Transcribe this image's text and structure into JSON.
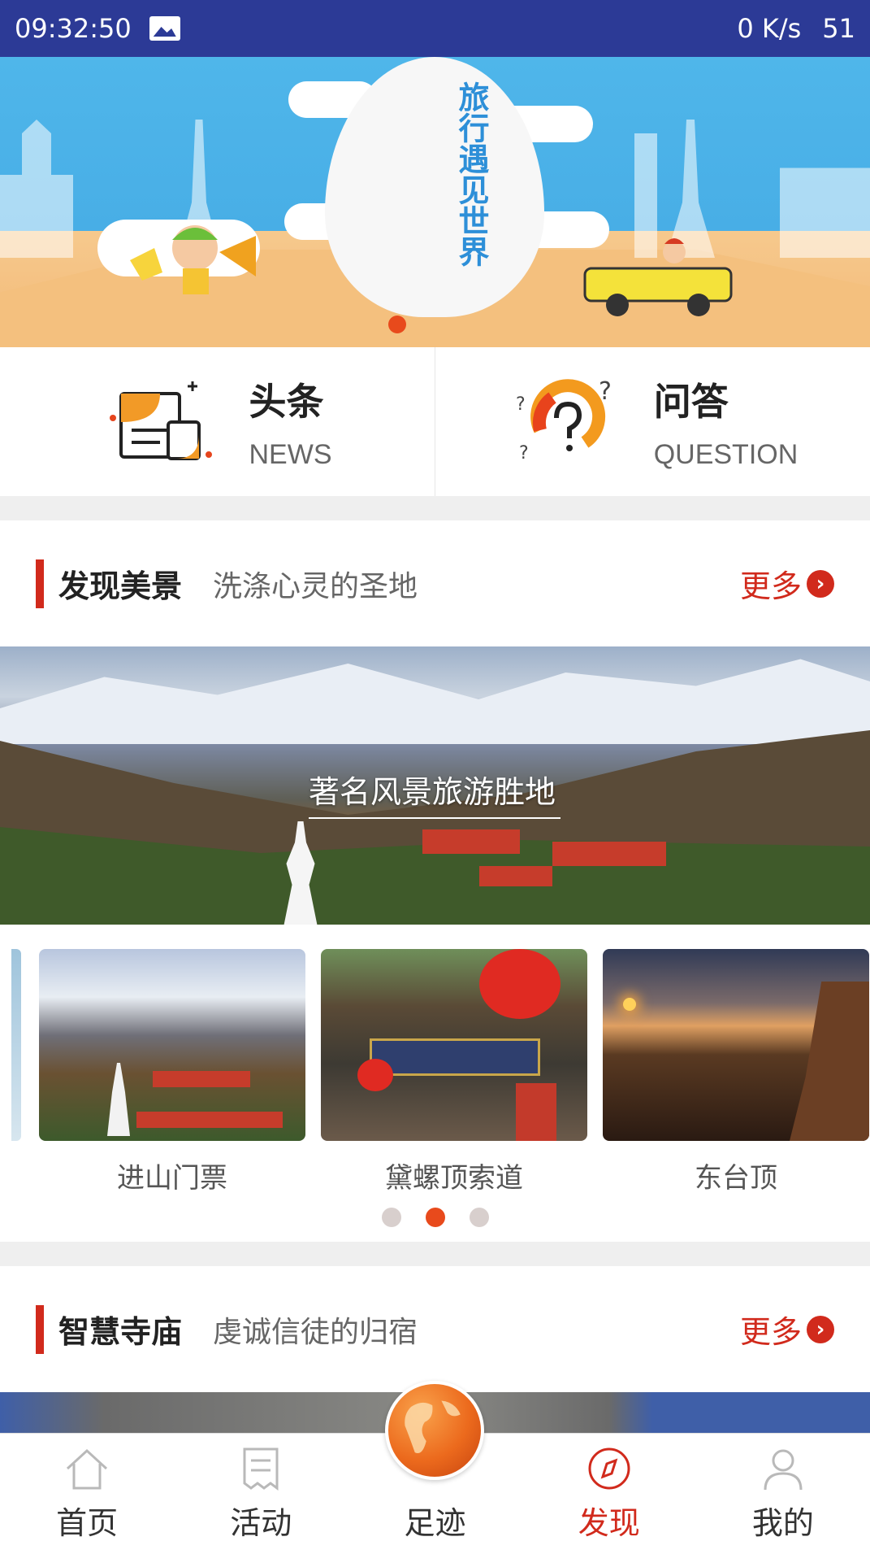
{
  "status_bar": {
    "time": "09:32:50",
    "speed": "0 K/s",
    "battery": "51"
  },
  "banner": {
    "slogan": "旅行遇见世界"
  },
  "quick_entries": [
    {
      "title": "头条",
      "subtitle": "NEWS",
      "icon": "news-document-icon"
    },
    {
      "title": "问答",
      "subtitle": "QUESTION",
      "icon": "question-mark-icon"
    }
  ],
  "section_scenery": {
    "title": "发现美景",
    "subtitle": "洗涤心灵的圣地",
    "more": "更多"
  },
  "hero": {
    "caption": "著名风景旅游胜地"
  },
  "carousel": {
    "cards": [
      {
        "label": "进山门票"
      },
      {
        "label": "黛螺顶索道"
      },
      {
        "label": "东台顶"
      }
    ],
    "active_dot": 1
  },
  "section_temple": {
    "title": "智慧寺庙",
    "subtitle": "虔诚信徒的归宿",
    "more": "更多"
  },
  "tabs": [
    {
      "label": "首页",
      "icon": "home-icon"
    },
    {
      "label": "活动",
      "icon": "activity-list-icon"
    },
    {
      "label": "足迹",
      "icon": "globe-icon"
    },
    {
      "label": "发现",
      "icon": "compass-icon",
      "active": true
    },
    {
      "label": "我的",
      "icon": "profile-icon"
    }
  ],
  "colors": {
    "status_bar": "#2c3a96",
    "accent": "#d12a1c",
    "inactive_dot": "#d8cfcd",
    "active_dot": "#e84a1c"
  }
}
